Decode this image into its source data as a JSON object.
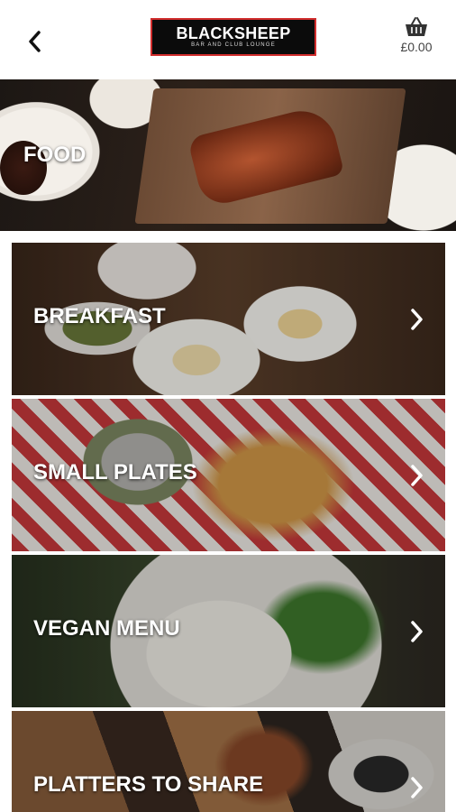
{
  "header": {
    "brand_title": "BLACKSHEEP",
    "brand_subtitle": "BAR AND CLUB LOUNGE",
    "basket_total": "£0.00",
    "icons": {
      "back": "chevron-left-icon",
      "basket": "basket-icon"
    },
    "colors": {
      "logo_bg": "#0b0b0b",
      "logo_border": "#d12d2d"
    }
  },
  "hero": {
    "label": "FOOD"
  },
  "categories": [
    {
      "label": "BREAKFAST"
    },
    {
      "label": "SMALL PLATES"
    },
    {
      "label": "VEGAN MENU"
    },
    {
      "label": "PLATTERS TO SHARE"
    }
  ]
}
